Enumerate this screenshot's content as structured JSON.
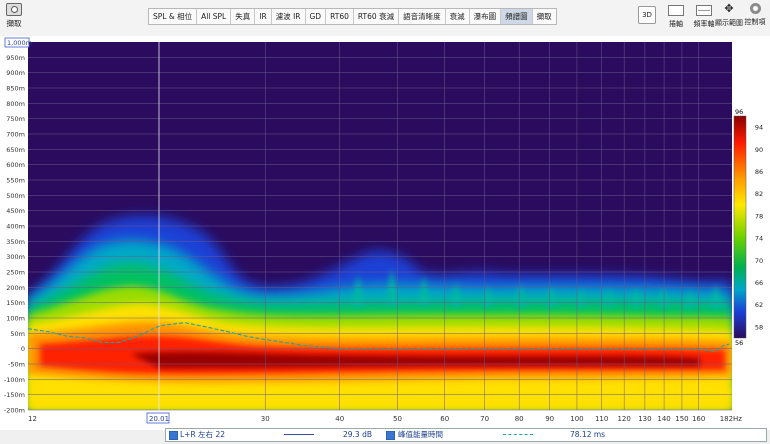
{
  "toolbar": {
    "capture_label": "擷取",
    "tabs": [
      "SPL & 相位",
      "All SPL",
      "失真",
      "IR",
      "濾波 IR",
      "GD",
      "RT60",
      "RT60 衰減",
      "語音清晰度",
      "衰減",
      "瀑布圖",
      "頻譜圖",
      "擷取"
    ],
    "active_tab": "頻譜圖",
    "btn_3d": "3D",
    "right_tools": [
      {
        "label": "捲軸",
        "icon": "lock-icon"
      },
      {
        "label": "頻率軸",
        "icon": "frequency-axis-icon"
      },
      {
        "label": "顯示範圍",
        "icon": "fit-range-icon"
      },
      {
        "label": "控制項",
        "icon": "gear-icon"
      }
    ]
  },
  "spectrogram": {
    "top_tick_label": "1,000m",
    "y_tick_labels": [
      "950m",
      "900m",
      "850m",
      "800m",
      "750m",
      "700m",
      "650m",
      "600m",
      "550m",
      "500m",
      "450m",
      "400m",
      "350m",
      "300m",
      "250m",
      "200m",
      "150m",
      "100m",
      "50m",
      "0",
      "-50m",
      "-100m",
      "-150m",
      "-200m"
    ],
    "x_tick_labels": [
      "12",
      "30",
      "40",
      "50",
      "60",
      "70",
      "80",
      "90",
      "100",
      "110",
      "120",
      "130",
      "140",
      "150",
      "160",
      "182Hz"
    ],
    "cursor_freq_label": "20.01",
    "colorbar": {
      "top": "96",
      "ticks": [
        "94",
        "90",
        "86",
        "82",
        "78",
        "74",
        "70",
        "66",
        "62",
        "58"
      ],
      "bottom": "56"
    },
    "colors": {
      "background": "#2a0b5e",
      "ridge_line": "#1aa6a6",
      "gridline": "#6a5a90"
    }
  },
  "chart_data": {
    "type": "heatmap",
    "x_axis": {
      "unit": "Hz",
      "range": [
        12,
        182
      ],
      "scale": "log"
    },
    "y_axis": {
      "unit": "s",
      "range": [
        -0.2,
        1.0
      ]
    },
    "color_scale": {
      "range": [
        56,
        96
      ],
      "unit": "dB"
    },
    "cursor_x": 20.01,
    "ridge_series": {
      "name": "峰值能量時間",
      "x": [
        12,
        13,
        14,
        15,
        16,
        17,
        18,
        19,
        20,
        22,
        24,
        26,
        28,
        30,
        35,
        40,
        50,
        60,
        80,
        100,
        130,
        160,
        170,
        176,
        180
      ],
      "y": [
        0.065,
        0.055,
        0.04,
        0.035,
        0.02,
        0.02,
        0.035,
        0.055,
        0.075,
        0.085,
        0.07,
        0.055,
        0.04,
        0.03,
        0.01,
        0.0,
        0.0,
        0.0,
        0.0,
        0.0,
        0.0,
        0.0,
        -0.01,
        0.01,
        0.015
      ]
    }
  },
  "legend": {
    "item1_name": "L+R 左右 22",
    "item1_value": "29.3 dB",
    "item2_name": "峰值能量時間",
    "item2_value": "78.12 ms"
  }
}
